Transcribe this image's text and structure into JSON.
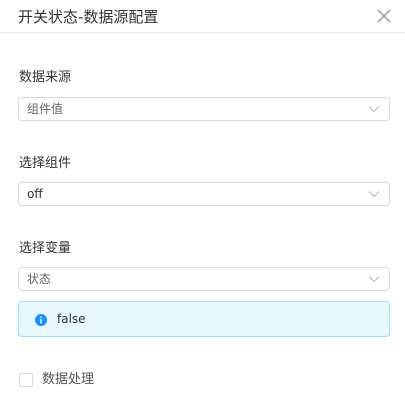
{
  "dialog": {
    "title": "开关状态-数据源配置"
  },
  "icons": {
    "close": "close-icon",
    "chevron": "chevron-down-icon",
    "info": "info-icon"
  },
  "colors": {
    "info_bg": "#e6f7fe",
    "info_border": "#a6dcf5",
    "info_icon": "#1890ff",
    "border": "#d9d9d9"
  },
  "source": {
    "label": "数据来源",
    "value": "组件值"
  },
  "component": {
    "label": "选择组件",
    "value": "off"
  },
  "variable": {
    "label": "选择变量",
    "value": "状态"
  },
  "info": {
    "text": "false"
  },
  "processing": {
    "label": "数据处理",
    "checked": false
  }
}
